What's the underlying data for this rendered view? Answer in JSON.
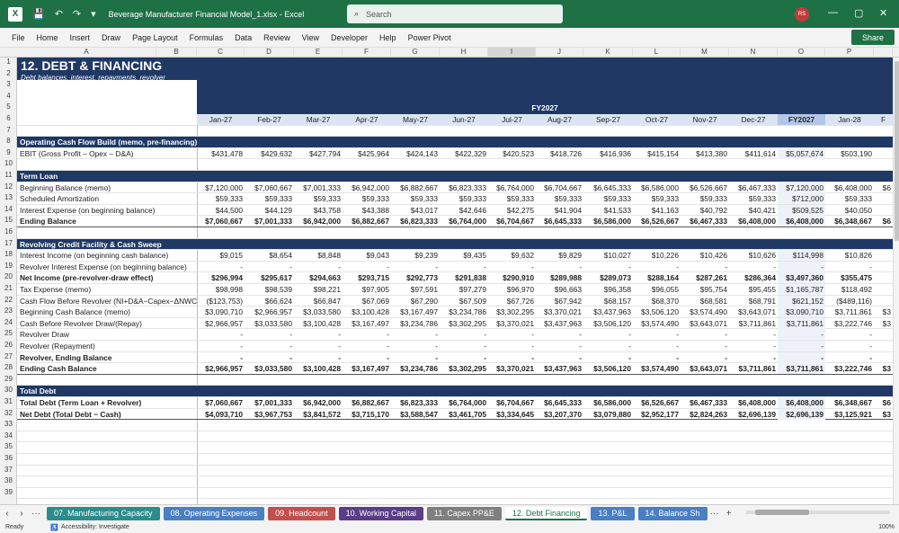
{
  "window": {
    "title": "Beverage Manufacturer Financial Model_1.xlsx  -  Excel",
    "search_placeholder": "Search",
    "avatar_initials": "RS",
    "app_icon": "X",
    "minimize": "—",
    "maximize": "▢",
    "close": "✕"
  },
  "menu": [
    "File",
    "Home",
    "Insert",
    "Draw",
    "Page Layout",
    "Formulas",
    "Data",
    "Review",
    "View",
    "Developer",
    "Help",
    "Power Pivot"
  ],
  "share_label": "Share",
  "columns": [
    "A",
    "B",
    "C",
    "D",
    "E",
    "F",
    "G",
    "H",
    "I",
    "J",
    "K",
    "L",
    "M",
    "N",
    "O",
    "P",
    ""
  ],
  "rows": [
    "1",
    "2",
    "3",
    "4",
    "5",
    "6",
    "7",
    "8",
    "9",
    "10",
    "11",
    "12",
    "13",
    "14",
    "15",
    "16",
    "17",
    "18",
    "19",
    "20",
    "21",
    "22",
    "23",
    "24",
    "25",
    "26",
    "27",
    "28",
    "29",
    "30",
    "31",
    "32",
    "33",
    "34",
    "35",
    "36",
    "37",
    "38",
    "39"
  ],
  "sheet": {
    "title": "12.  DEBT & FINANCING",
    "subtitle": "Debt balances, interest, repayments, revolver",
    "fy_label": "FY2027",
    "months": [
      "Jan-27",
      "Feb-27",
      "Mar-27",
      "Apr-27",
      "May-27",
      "Jun-27",
      "Jul-27",
      "Aug-27",
      "Sep-27",
      "Oct-27",
      "Nov-27",
      "Dec-27",
      "FY2027",
      "Jan-28",
      "F"
    ],
    "sections": {
      "op_cf": "Operating Cash Flow Build (memo, pre-financing)",
      "term_loan": "Term Loan",
      "revolver": "Revolving Credit Facility & Cash Sweep",
      "total_debt": "Total Debt"
    },
    "lines": [
      {
        "row": 9,
        "label": "EBIT (Gross Profit – Opex – D&A)",
        "bold": false,
        "vals": [
          "$431,478",
          "$429,632",
          "$427,794",
          "$425,964",
          "$424,143",
          "$422,329",
          "$420,523",
          "$418,726",
          "$416,936",
          "$415,154",
          "$413,380",
          "$411,614",
          "$5,057,674",
          "$503,190",
          ""
        ]
      },
      {
        "row": 12,
        "label": "Beginning Balance (memo)",
        "bold": false,
        "vals": [
          "$7,120,000",
          "$7,060,667",
          "$7,001,333",
          "$6,942,000",
          "$6,882,667",
          "$6,823,333",
          "$6,764,000",
          "$6,704,667",
          "$6,645,333",
          "$6,586,000",
          "$6,526,667",
          "$6,467,333",
          "$7,120,000",
          "$6,408,000",
          "$6"
        ]
      },
      {
        "row": 13,
        "label": "Scheduled Amortization",
        "bold": false,
        "vals": [
          "$59,333",
          "$59,333",
          "$59,333",
          "$59,333",
          "$59,333",
          "$59,333",
          "$59,333",
          "$59,333",
          "$59,333",
          "$59,333",
          "$59,333",
          "$59,333",
          "$712,000",
          "$59,333",
          ""
        ]
      },
      {
        "row": 14,
        "label": "Interest Expense (on beginning balance)",
        "bold": false,
        "vals": [
          "$44,500",
          "$44,129",
          "$43,758",
          "$43,388",
          "$43,017",
          "$42,646",
          "$42,275",
          "$41,904",
          "$41,533",
          "$41,163",
          "$40,792",
          "$40,421",
          "$509,525",
          "$40,050",
          ""
        ]
      },
      {
        "row": 15,
        "label": "Ending Balance",
        "bold": true,
        "vals": [
          "$7,060,667",
          "$7,001,333",
          "$6,942,000",
          "$6,882,667",
          "$6,823,333",
          "$6,764,000",
          "$6,704,667",
          "$6,645,333",
          "$6,586,000",
          "$6,526,667",
          "$6,467,333",
          "$6,408,000",
          "$6,408,000",
          "$6,348,667",
          "$6"
        ]
      },
      {
        "row": 18,
        "label": "Interest Income (on beginning cash balance)",
        "bold": false,
        "vals": [
          "$9,015",
          "$8,654",
          "$8,848",
          "$9,043",
          "$9,239",
          "$9,435",
          "$9,632",
          "$9,829",
          "$10,027",
          "$10,226",
          "$10,426",
          "$10,626",
          "$114,998",
          "$10,826",
          ""
        ]
      },
      {
        "row": 19,
        "label": "Revolver Interest Expense (on beginning balance)",
        "bold": false,
        "vals": [
          "-",
          "-",
          "-",
          "-",
          "-",
          "-",
          "-",
          "-",
          "-",
          "-",
          "-",
          "-",
          "-",
          "-",
          ""
        ]
      },
      {
        "row": 20,
        "label": "Net Income (pre-revolver-draw effect)",
        "bold": true,
        "vals": [
          "$296,994",
          "$295,617",
          "$294,663",
          "$293,715",
          "$292,773",
          "$291,838",
          "$290,910",
          "$289,988",
          "$289,073",
          "$288,164",
          "$287,261",
          "$286,364",
          "$3,497,360",
          "$355,475",
          ""
        ]
      },
      {
        "row": 21,
        "label": "  Tax Expense (memo)",
        "bold": false,
        "vals": [
          "$98,998",
          "$98,539",
          "$98,221",
          "$97,905",
          "$97,591",
          "$97,279",
          "$96,970",
          "$96,663",
          "$96,358",
          "$96,055",
          "$95,754",
          "$95,455",
          "$1,165,787",
          "$118,492",
          ""
        ]
      },
      {
        "row": 22,
        "label": "Cash Flow Before Revolver (NI+D&A−Capex−ΔNWC",
        "bold": false,
        "vals": [
          "($123,753)",
          "$66,624",
          "$66,847",
          "$67,069",
          "$67,290",
          "$67,509",
          "$67,726",
          "$67,942",
          "$68,157",
          "$68,370",
          "$68,581",
          "$68,791",
          "$621,152",
          "($489,116)",
          ""
        ]
      },
      {
        "row": 23,
        "label": "Beginning Cash Balance (memo)",
        "bold": false,
        "vals": [
          "$3,090,710",
          "$2,966,957",
          "$3,033,580",
          "$3,100,428",
          "$3,167,497",
          "$3,234,786",
          "$3,302,295",
          "$3,370,021",
          "$3,437,963",
          "$3,506,120",
          "$3,574,490",
          "$3,643,071",
          "$3,090,710",
          "$3,711,861",
          "$3"
        ]
      },
      {
        "row": 24,
        "label": "Cash Before Revolver Draw/(Repay)",
        "bold": false,
        "vals": [
          "$2,966,957",
          "$3,033,580",
          "$3,100,428",
          "$3,167,497",
          "$3,234,786",
          "$3,302,295",
          "$3,370,021",
          "$3,437,963",
          "$3,506,120",
          "$3,574,490",
          "$3,643,071",
          "$3,711,861",
          "$3,711,861",
          "$3,222,746",
          "$3"
        ]
      },
      {
        "row": 25,
        "label": "Revolver Draw",
        "bold": false,
        "vals": [
          "-",
          "-",
          "-",
          "-",
          "-",
          "-",
          "-",
          "-",
          "-",
          "-",
          "-",
          "-",
          "-",
          "-",
          ""
        ]
      },
      {
        "row": 26,
        "label": "Revolver (Repayment)",
        "bold": false,
        "vals": [
          "-",
          "-",
          "-",
          "-",
          "-",
          "-",
          "-",
          "-",
          "-",
          "-",
          "-",
          "-",
          "-",
          "-",
          ""
        ]
      },
      {
        "row": 27,
        "label": "Revolver, Ending Balance",
        "bold": true,
        "vals": [
          "-",
          "-",
          "-",
          "-",
          "-",
          "-",
          "-",
          "-",
          "-",
          "-",
          "-",
          "-",
          "-",
          "-",
          ""
        ]
      },
      {
        "row": 28,
        "label": "Ending Cash Balance",
        "bold": true,
        "vals": [
          "$2,966,957",
          "$3,033,580",
          "$3,100,428",
          "$3,167,497",
          "$3,234,786",
          "$3,302,295",
          "$3,370,021",
          "$3,437,963",
          "$3,506,120",
          "$3,574,490",
          "$3,643,071",
          "$3,711,861",
          "$3,711,861",
          "$3,222,746",
          "$3"
        ]
      },
      {
        "row": 31,
        "label": "Total Debt (Term Loan + Revolver)",
        "bold": true,
        "vals": [
          "$7,060,667",
          "$7,001,333",
          "$6,942,000",
          "$6,882,667",
          "$6,823,333",
          "$6,764,000",
          "$6,704,667",
          "$6,645,333",
          "$6,586,000",
          "$6,526,667",
          "$6,467,333",
          "$6,408,000",
          "$6,408,000",
          "$6,348,667",
          "$6"
        ]
      },
      {
        "row": 32,
        "label": "Net Debt (Total Debt − Cash)",
        "bold": true,
        "vals": [
          "$4,093,710",
          "$3,967,753",
          "$3,841,572",
          "$3,715,170",
          "$3,588,547",
          "$3,461,705",
          "$3,334,645",
          "$3,207,370",
          "$3,079,880",
          "$2,952,177",
          "$2,824,263",
          "$2,696,139",
          "$2,696,139",
          "$3,125,921",
          "$3"
        ]
      }
    ]
  },
  "tabs": [
    {
      "label": "07. Manufacturing Capacity",
      "color": "#2e8b8b"
    },
    {
      "label": "08. Operating Expenses",
      "color": "#4a7fc1"
    },
    {
      "label": "09. Headcount",
      "color": "#c0504d"
    },
    {
      "label": "10. Working Capital",
      "color": "#5b3c88"
    },
    {
      "label": "11. Capex PP&E",
      "color": "#7f7f7f"
    },
    {
      "label": "12. Debt Financing",
      "color": "#ffffff",
      "active": true
    },
    {
      "label": "13. P&L",
      "color": "#4a7fc1"
    },
    {
      "label": "14. Balance Sh",
      "color": "#4a7fc1"
    }
  ],
  "tab_nav": {
    "prev": "‹",
    "next": "›",
    "more": "···",
    "add": "+"
  },
  "status": {
    "ready": "Ready",
    "accessibility": "Accessibility: Investigate",
    "zoom": "100%"
  },
  "colors": {
    "band": "#1f3864",
    "excel_green": "#1e7145"
  }
}
